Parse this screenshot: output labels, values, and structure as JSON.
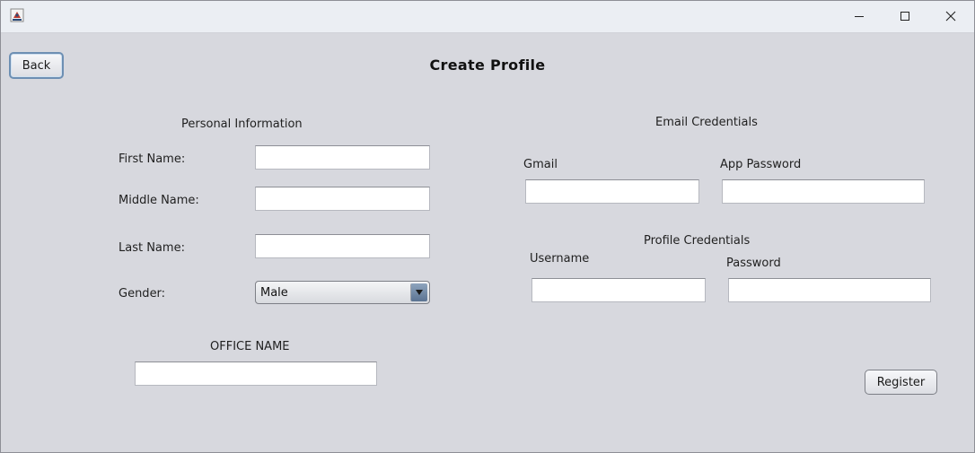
{
  "page": {
    "title": "Create Profile",
    "back_label": "Back",
    "register_label": "Register"
  },
  "personal": {
    "heading": "Personal Information",
    "first_name_label": "First Name:",
    "first_name_value": "",
    "middle_name_label": "Middle Name:",
    "middle_name_value": "",
    "last_name_label": "Last Name:",
    "last_name_value": "",
    "gender_label": "Gender:",
    "gender_value": "Male",
    "office_name_label": "OFFICE NAME",
    "office_name_value": ""
  },
  "email": {
    "heading": "Email Credentials",
    "gmail_label": "Gmail",
    "gmail_value": "",
    "app_password_label": "App Password",
    "app_password_value": ""
  },
  "profile": {
    "heading": "Profile Credentials",
    "username_label": "Username",
    "username_value": "",
    "password_label": "Password",
    "password_value": ""
  },
  "icons": {
    "app": "java-app-icon",
    "minimize": "minimize-icon",
    "maximize": "maximize-icon",
    "close": "close-icon",
    "dropdown": "chevron-down-icon"
  }
}
